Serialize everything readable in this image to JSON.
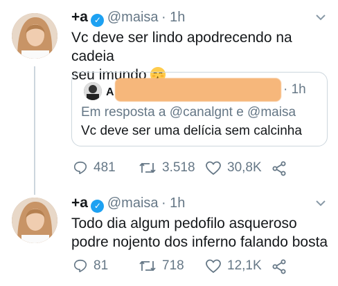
{
  "tweets": [
    {
      "name": "+a",
      "handle": "@maisa",
      "time": "· 1h",
      "text_line1": "Vc deve ser lindo apodrecendo na cadeia",
      "text_line2": "seu imundo",
      "emoji": "kissing-face-emoji",
      "quote": {
        "time": "1h",
        "reply_prefix": "Em resposta a",
        "reply_handle1": "@canalgnt",
        "reply_and": "e",
        "reply_handle2": "@maisa",
        "text": "Vc deve ser uma delícia sem calcinha"
      },
      "replies": "481",
      "retweets": "3.518",
      "likes": "30,8K"
    },
    {
      "name": "+a",
      "handle": "@maisa",
      "time": "· 1h",
      "text_line1": "Todo dia algum pedofilo asqueroso",
      "text_line2": "podre nojento dos inferno falando bosta",
      "replies": "81",
      "retweets": "718",
      "likes": "12,1K"
    }
  ],
  "colors": {
    "accent": "#1da1f2",
    "muted": "#657786",
    "text": "#14171a",
    "redaction": "#f6b77b"
  }
}
